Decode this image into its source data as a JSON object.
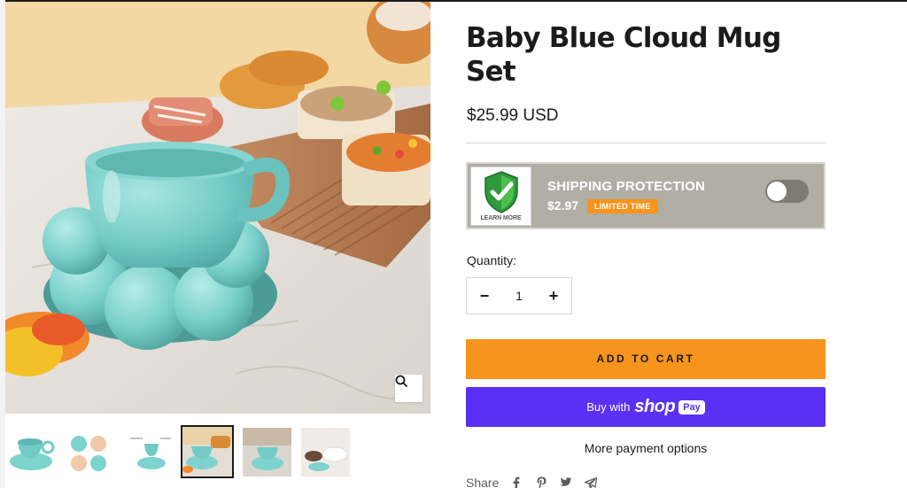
{
  "product": {
    "title": "Baby Blue Cloud Mug Set",
    "price": "$25.99 USD"
  },
  "gallery": {
    "main_image_alt": "main-product-image",
    "thumbnail_count": 6,
    "active_thumbnail_index": 4
  },
  "shipping_protection": {
    "learn_more": "LEARN MORE",
    "title": "SHIPPING PROTECTION",
    "price": "$2.97",
    "tag": "LIMITED TIME",
    "enabled": false
  },
  "quantity": {
    "label": "Quantity:",
    "minus": "−",
    "value": "1",
    "plus": "+"
  },
  "buttons": {
    "add_to_cart": "ADD TO CART",
    "buy_with": "Buy with",
    "shop_word": "shop",
    "pay": "Pay",
    "more_payment": "More payment options"
  },
  "share": {
    "label": "Share",
    "icons": [
      "facebook-icon",
      "pinterest-icon",
      "twitter-icon",
      "email-icon"
    ]
  },
  "colors": {
    "accent_orange": "#f7941d",
    "shop_purple": "#5a31f4",
    "shipping_bg": "#b1aea6",
    "mug_blue": "#7fd3cf"
  }
}
